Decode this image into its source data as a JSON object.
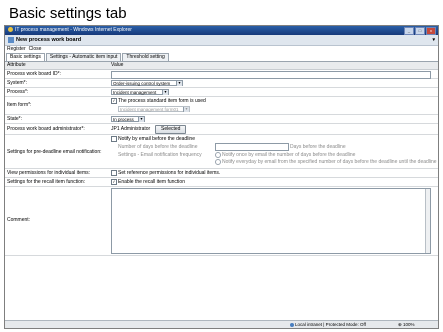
{
  "slide": {
    "title": "Basic settings tab"
  },
  "window": {
    "title": "IT process management - Windows Internet Explorer",
    "app_title": "New process work board",
    "menu": [
      "Register",
      "Close"
    ]
  },
  "tabs": [
    "Basic settings",
    "Settings - Automatic item input",
    "Threshold setting"
  ],
  "table": {
    "col_attribute": "Attribute",
    "col_value": "Value"
  },
  "fields": {
    "process_work_board_id": {
      "label": "Process work board ID*:",
      "value": ""
    },
    "system": {
      "label": "System*:",
      "value": "Order-issuing control system"
    },
    "process": {
      "label": "Process*:",
      "value": "Incident management"
    },
    "item_form": {
      "label": "Item form*:",
      "checkbox": "The process standard item form is used",
      "checked": true,
      "select": "Incident management form01"
    },
    "state": {
      "label": "State*:",
      "value": "In process"
    },
    "admin": {
      "label": "Process work board administrator*:",
      "value": "JP1 Administrator",
      "button": "Selected"
    },
    "email": {
      "label": "Settings for pre-deadline email notification:",
      "checkbox": "Notify by email before the deadline",
      "checked": false,
      "days_label": "Number of days before the deadline",
      "days_suffix": "Days before the deadline",
      "freq_label": "Settings - Email notification frequency",
      "radio1": "Notify once by email the number of days before the deadline",
      "radio2": "Notify everyday by email from the specified number of days before the deadline until the deadline"
    },
    "view_perm": {
      "label": "View permissions for individual items:",
      "checkbox": "Set reference permissions for individual items.",
      "checked": false
    },
    "recall": {
      "label": "Settings for the recall item function:",
      "checkbox": "Enable the recall item function",
      "checked": true
    },
    "comment": {
      "label": "Comment:"
    }
  },
  "status": {
    "zone": "Local intranet | Protected Mode: Off",
    "zoom": "100%"
  }
}
